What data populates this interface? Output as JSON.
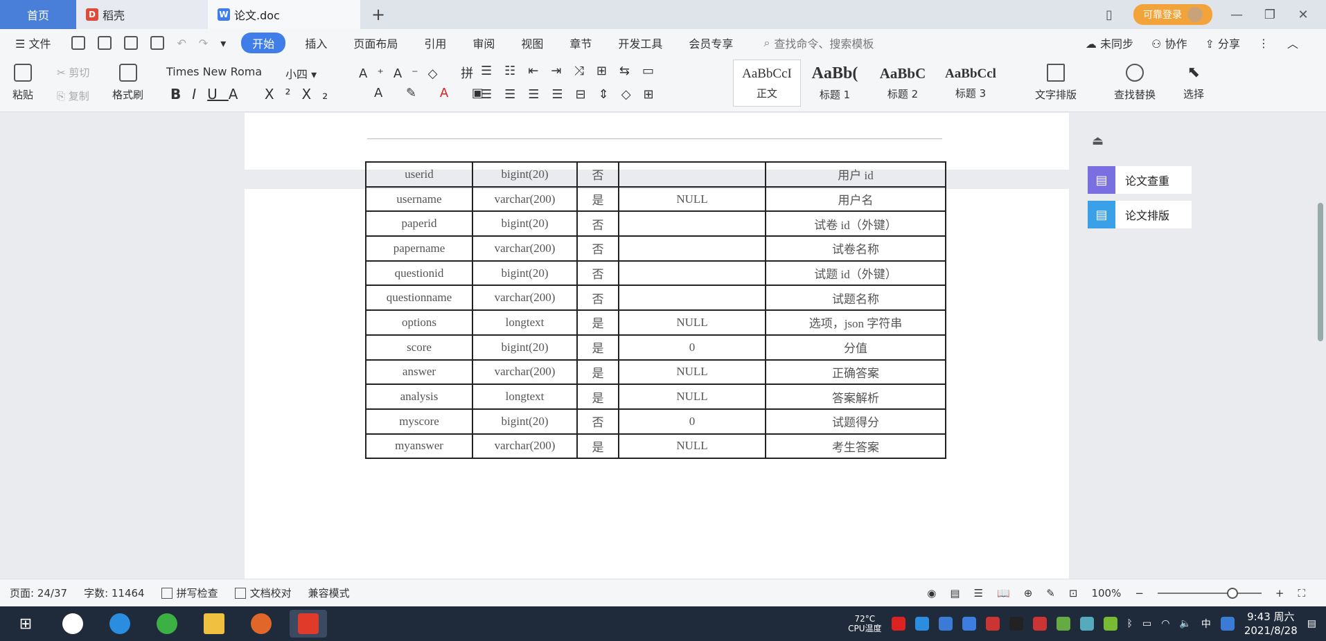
{
  "titlebar": {
    "tabs": [
      {
        "label": "首页"
      },
      {
        "label": "稻壳"
      },
      {
        "label": "论文.doc"
      }
    ],
    "login_label": "可靠登录"
  },
  "menubar": {
    "file_label": "文件",
    "items": [
      "开始",
      "插入",
      "页面布局",
      "引用",
      "审阅",
      "视图",
      "章节",
      "开发工具",
      "会员专享"
    ],
    "search_placeholder": "查找命令、搜索模板",
    "sync_label": "未同步",
    "collab_label": "协作",
    "share_label": "分享"
  },
  "ribbon": {
    "paste_label": "粘贴",
    "cut_label": "剪切",
    "copy_label": "复制",
    "format_painter_label": "格式刷",
    "font_name": "Times New Roma",
    "font_size": "小四",
    "styles": [
      {
        "preview": "AaBbCcI",
        "name": "正文"
      },
      {
        "preview": "AaBb(",
        "name": "标题 1"
      },
      {
        "preview": "AaBbC",
        "name": "标题 2"
      },
      {
        "preview": "AaBbCcl",
        "name": "标题 3"
      }
    ],
    "text_layout_label": "文字排版",
    "find_replace_label": "查找替换",
    "select_label": "选择"
  },
  "document": {
    "table_rows": [
      [
        "userid",
        "bigint(20)",
        "否",
        "",
        "用户 id"
      ],
      [
        "username",
        "varchar(200)",
        "是",
        "NULL",
        "用户名"
      ],
      [
        "paperid",
        "bigint(20)",
        "否",
        "",
        "试卷 id（外键）"
      ],
      [
        "papername",
        "varchar(200)",
        "否",
        "",
        "试卷名称"
      ],
      [
        "questionid",
        "bigint(20)",
        "否",
        "",
        "试题 id（外键）"
      ],
      [
        "questionname",
        "varchar(200)",
        "否",
        "",
        "试题名称"
      ],
      [
        "options",
        "longtext",
        "是",
        "NULL",
        "选项，json 字符串"
      ],
      [
        "score",
        "bigint(20)",
        "是",
        "0",
        "分值"
      ],
      [
        "answer",
        "varchar(200)",
        "是",
        "NULL",
        "正确答案"
      ],
      [
        "analysis",
        "longtext",
        "是",
        "NULL",
        "答案解析"
      ],
      [
        "myscore",
        "bigint(20)",
        "否",
        "0",
        "试题得分"
      ],
      [
        "myanswer",
        "varchar(200)",
        "是",
        "NULL",
        "考生答案"
      ]
    ]
  },
  "sidepanel": {
    "check_label": "论文查重",
    "layout_label": "论文排版"
  },
  "statusbar": {
    "page": "页面: 24/37",
    "words": "字数: 11464",
    "spellcheck": "拼写检查",
    "proofread": "文档校对",
    "compat": "兼容模式",
    "zoom": "100%"
  },
  "taskbar": {
    "temp": "72°C",
    "temp_label": "CPU温度",
    "ime": "中",
    "time": "9:43 周六",
    "date": "2021/8/28"
  }
}
